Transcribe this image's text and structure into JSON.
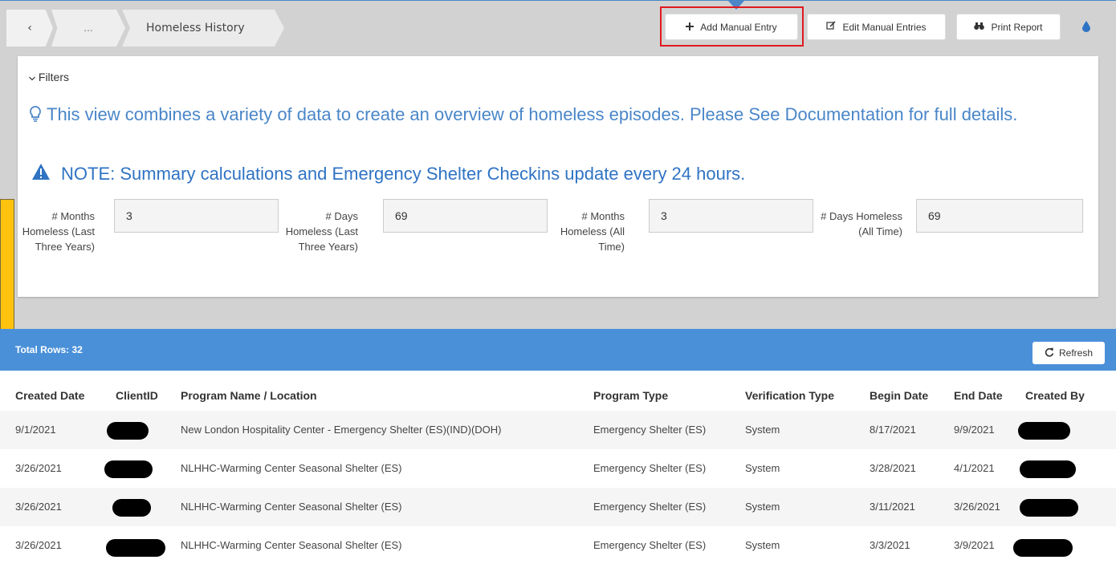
{
  "breadcrumb": {
    "back_glyph": "‹",
    "ellipsis": "...",
    "current": "Homeless History"
  },
  "toolbar": {
    "add_manual_entry": "Add Manual Entry",
    "edit_manual_entries": "Edit Manual Entries",
    "print_report": "Print Report"
  },
  "filters": {
    "toggle_label": "Filters",
    "info_text": "This view combines a variety of data to create an overview of homeless episodes. Please See Documentation for full details.",
    "note_text": "NOTE: Summary calculations and Emergency Shelter Checkins update every 24 hours.",
    "stats": [
      {
        "label": "# Months Homeless (Last Three Years)",
        "value": "3"
      },
      {
        "label": "# Days Homeless (Last Three Years)",
        "value": "69"
      },
      {
        "label": "# Months Homeless (All Time)",
        "value": "3"
      },
      {
        "label": "# Days Homeless (All Time)",
        "value": "69"
      }
    ]
  },
  "table": {
    "total_rows_label": "Total Rows: 32",
    "refresh_label": "Refresh",
    "columns": [
      "Created Date",
      "ClientID",
      "Program Name / Location",
      "Program Type",
      "Verification Type",
      "Begin Date",
      "End Date",
      "Created By"
    ],
    "rows": [
      {
        "created_date": "9/1/2021",
        "program": "New London Hospitality Center - Emergency Shelter (ES)(IND)(DOH)",
        "program_type": "Emergency Shelter (ES)",
        "verification": "System",
        "begin": "8/17/2021",
        "end": "9/9/2021"
      },
      {
        "created_date": "3/26/2021",
        "program": "NLHHC-Warming Center Seasonal Shelter (ES)",
        "program_type": "Emergency Shelter (ES)",
        "verification": "System",
        "begin": "3/28/2021",
        "end": "4/1/2021"
      },
      {
        "created_date": "3/26/2021",
        "program": "NLHHC-Warming Center Seasonal Shelter (ES)",
        "program_type": "Emergency Shelter (ES)",
        "verification": "System",
        "begin": "3/11/2021",
        "end": "3/26/2021"
      },
      {
        "created_date": "3/26/2021",
        "program": "NLHHC-Warming Center Seasonal Shelter (ES)",
        "program_type": "Emergency Shelter (ES)",
        "verification": "System",
        "begin": "3/3/2021",
        "end": "3/9/2021"
      }
    ]
  },
  "colors": {
    "accent": "#4a90d9",
    "highlight": "#e0191e",
    "callout": "#ffc20e"
  }
}
